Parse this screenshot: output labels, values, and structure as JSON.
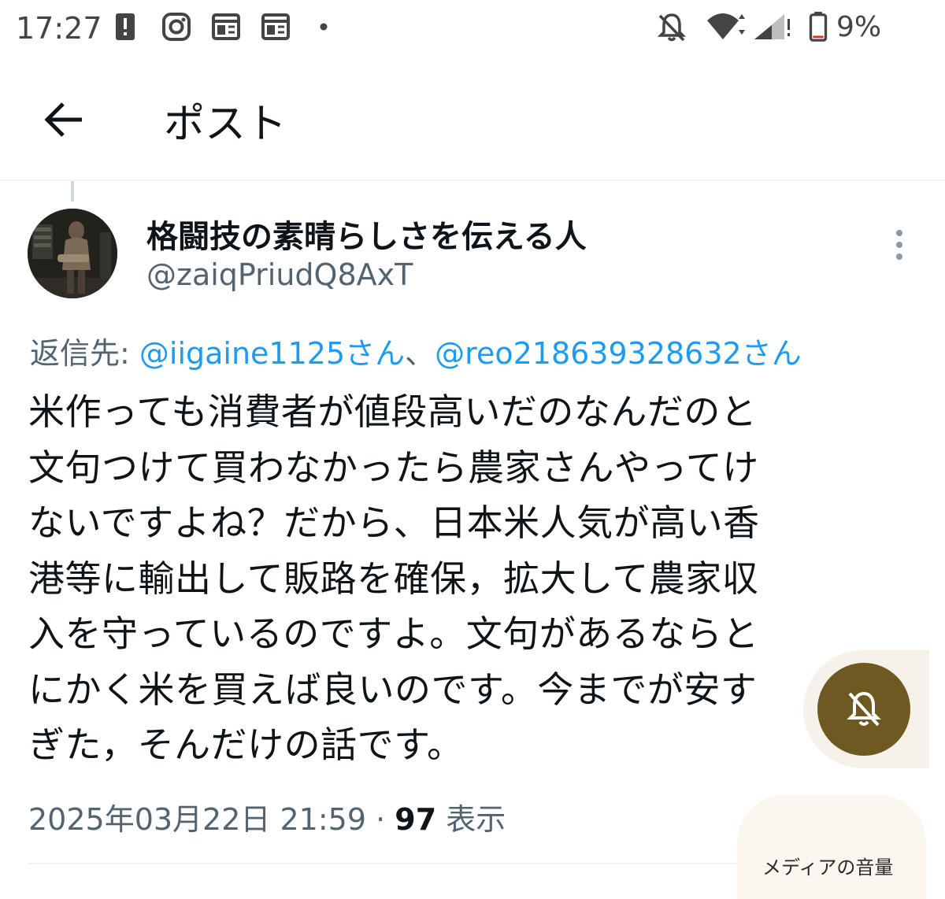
{
  "status_bar": {
    "time": "17:27",
    "battery_percent": "9%",
    "icons": [
      "alert-icon",
      "instagram-icon",
      "news-icon",
      "news-icon",
      "dot-icon",
      "notifications-off-icon",
      "wifi-icon",
      "signal-icon",
      "battery-icon"
    ]
  },
  "header": {
    "title": "ポスト",
    "back_icon": "arrow-left-icon"
  },
  "author": {
    "display_name": "格闘技の素晴らしさを伝える人",
    "handle": "@zaiqPriudQ8AxT"
  },
  "reply_to": {
    "prefix": "返信先: ",
    "mention1": "@iigaine1125さん",
    "separator": "、",
    "mention2": "@reo218639328632さん"
  },
  "post": {
    "lines": [
      "米作っても消費者が値段高いだのなんだのと",
      "文句つけて買わなかったら農家さんやってけ",
      "ないですよね？だから、日本米人気が高い香",
      "港等に輸出して販路を確保，拡大して農家収",
      "入を守っているのですよ。文句があるならと",
      "にかく米を買えば良いのです。今までが安す",
      "ぎた，そんだけの話です。"
    ]
  },
  "meta": {
    "timestamp": "2025年03月22日 21:59",
    "separator": " · ",
    "views_count": "97",
    "views_label": " 表示"
  },
  "overlay": {
    "mute_icon": "bell-off-icon",
    "media_volume_label": "メディアの音量"
  },
  "colors": {
    "link": "#1d9bf0",
    "secondary_text": "#536471",
    "primary_text": "#0f1419",
    "mute_button": "#6e5a20"
  }
}
